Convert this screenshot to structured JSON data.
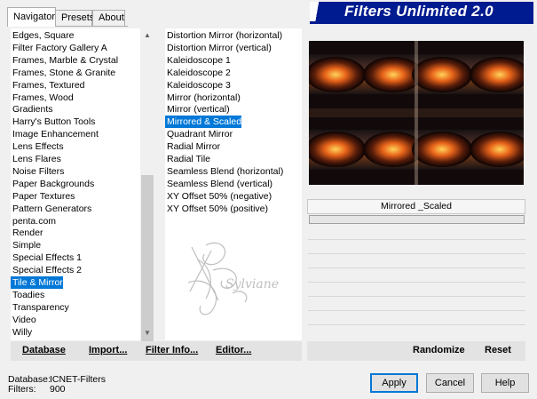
{
  "tabs": [
    {
      "label": "Navigator",
      "active": true
    },
    {
      "label": "Presets",
      "active": false
    },
    {
      "label": "About",
      "active": false
    }
  ],
  "banner": {
    "title": "Filters Unlimited 2.0",
    "color": "#001b8f"
  },
  "categories": [
    "Edges, Square",
    "Filter Factory Gallery A",
    "Frames, Marble & Crystal",
    "Frames, Stone & Granite",
    "Frames, Textured",
    "Frames, Wood",
    "Gradients",
    "Harry's Button Tools",
    "Image Enhancement",
    "Lens Effects",
    "Lens Flares",
    "Noise Filters",
    "Paper Backgrounds",
    "Paper Textures",
    "Pattern Generators",
    "penta.com",
    "Render",
    "Simple",
    "Special Effects 1",
    "Special Effects 2",
    "Tile & Mirror",
    "Toadies",
    "Transparency",
    "Video",
    "Willy"
  ],
  "selected_category": "Tile & Mirror",
  "filters": [
    "Distortion Mirror (horizontal)",
    "Distortion Mirror (vertical)",
    "Kaleidoscope 1",
    "Kaleidoscope 2",
    "Kaleidoscope 3",
    "Mirror (horizontal)",
    "Mirror (vertical)",
    "Mirrored & Scaled",
    "Quadrant Mirror",
    "Radial Mirror",
    "Radial Tile",
    "Seamless Blend (horizontal)",
    "Seamless Blend (vertical)",
    "XY Offset 50% (negative)",
    "XY Offset 50% (positive)"
  ],
  "selected_filter": "Mirrored & Scaled",
  "preview": {
    "filter_title": "Mirrored _Scaled"
  },
  "watermark": {
    "text": "Sylviane"
  },
  "toolbar": {
    "database": "Database",
    "import": "Import...",
    "filter_info": "Filter Info...",
    "editor": "Editor...",
    "randomize": "Randomize",
    "reset": "Reset"
  },
  "status": {
    "database_label": "Database:",
    "database_value": "ICNET-Filters",
    "filters_label": "Filters:",
    "filters_value": "900"
  },
  "buttons": {
    "apply": "Apply",
    "cancel": "Cancel",
    "help": "Help"
  },
  "colors": {
    "selection": "#0078d7",
    "accent": "#001b8f"
  }
}
